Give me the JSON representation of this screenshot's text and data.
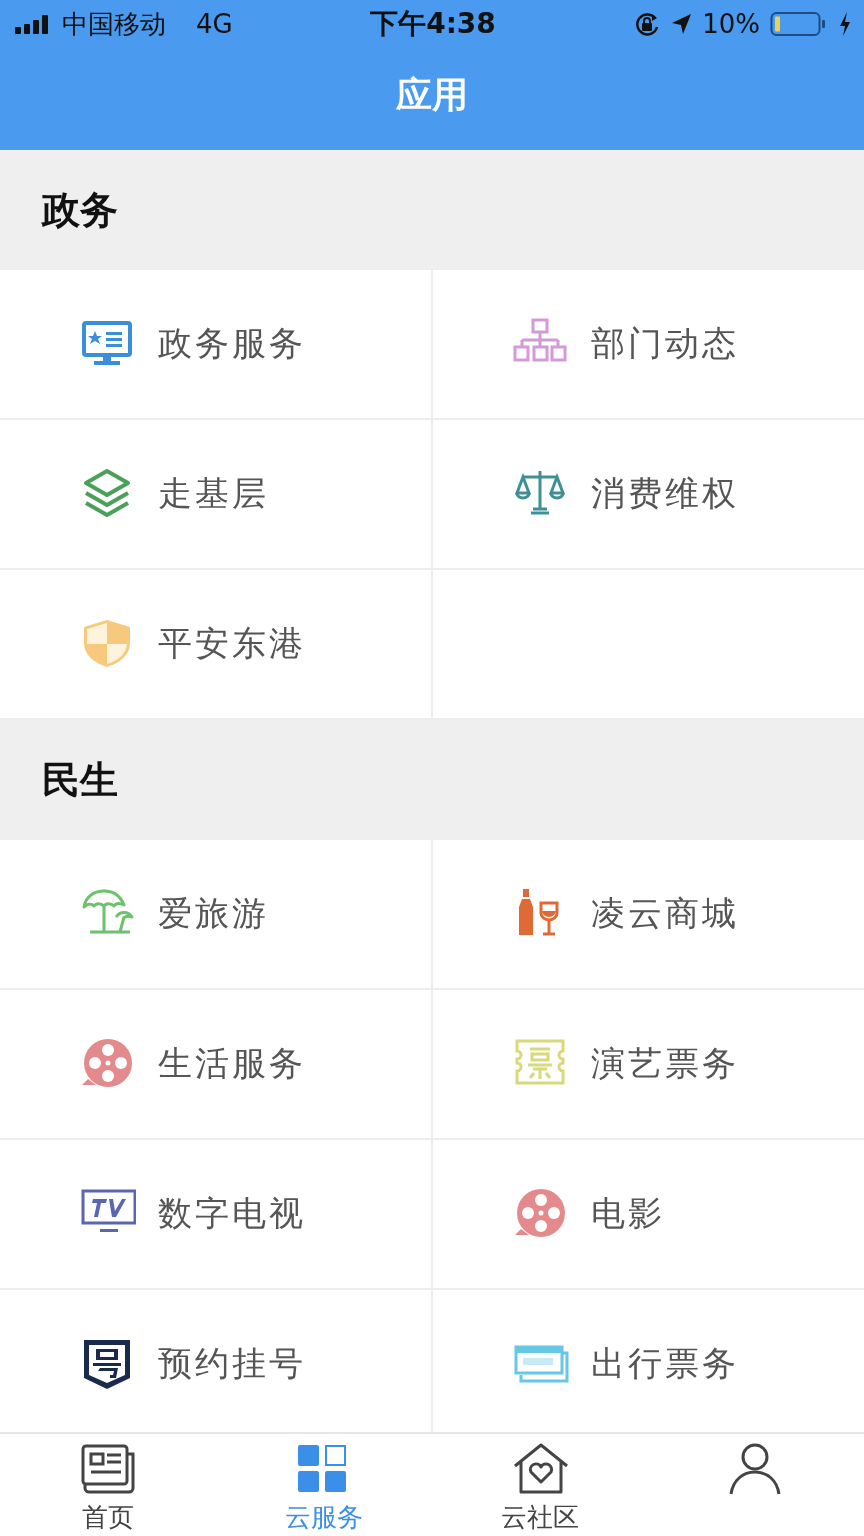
{
  "status_bar": {
    "carrier": "中国移动",
    "network": "4G",
    "time": "下午4:38",
    "battery": "10%"
  },
  "header": {
    "title": "应用"
  },
  "sections": [
    {
      "title": "政务",
      "items": [
        {
          "label": "政务服务",
          "kind": "monitor"
        },
        {
          "label": "部门动态",
          "kind": "orgchart"
        },
        {
          "label": "走基层",
          "kind": "layers"
        },
        {
          "label": "消费维权",
          "kind": "scales"
        },
        {
          "label": "平安东港",
          "kind": "shield"
        }
      ]
    },
    {
      "title": "民生",
      "items": [
        {
          "label": "爱旅游",
          "kind": "umbrella"
        },
        {
          "label": "凌云商城",
          "kind": "wine"
        },
        {
          "label": "生活服务",
          "kind": "reel"
        },
        {
          "label": "演艺票务",
          "kind": "stamp"
        },
        {
          "label": "数字电视",
          "kind": "tv"
        },
        {
          "label": "电影",
          "kind": "reel"
        },
        {
          "label": "预约挂号",
          "kind": "badge"
        },
        {
          "label": "出行票务",
          "kind": "ticket"
        }
      ]
    }
  ],
  "tab_bar": [
    {
      "label": "首页",
      "kind": "news",
      "selected": false
    },
    {
      "label": "云服务",
      "kind": "grid",
      "selected": true
    },
    {
      "label": "云社区",
      "kind": "house",
      "selected": false
    },
    {
      "kind": "person",
      "selected": false
    }
  ]
}
